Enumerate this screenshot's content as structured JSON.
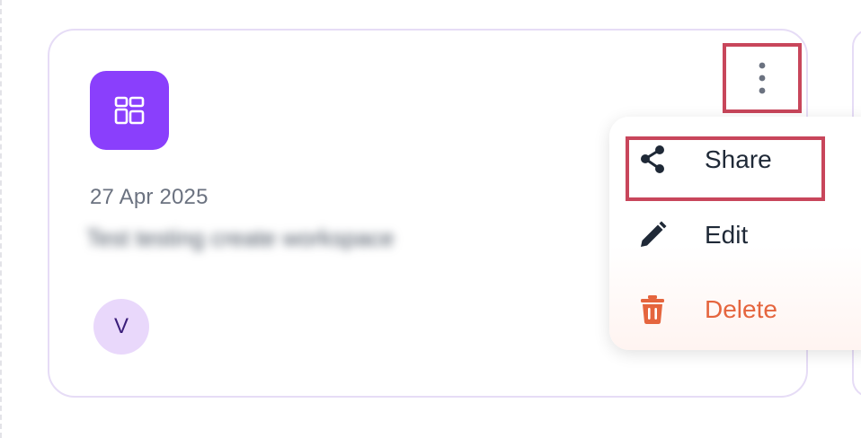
{
  "card": {
    "date": "27 Apr 2025",
    "title": "Test testing create workspace",
    "avatar_initial": "V",
    "icon": "grid-dashboard-icon",
    "icon_color": "#8a3ffc"
  },
  "menu": {
    "items": [
      {
        "label": "Share",
        "icon": "share-icon"
      },
      {
        "label": "Edit",
        "icon": "pencil-icon"
      },
      {
        "label": "Delete",
        "icon": "trash-icon",
        "color": "#e5653e"
      }
    ]
  },
  "colors": {
    "highlight": "#c8465b",
    "card_border": "#e6dcf6",
    "avatar_bg": "#e9d8fb"
  }
}
